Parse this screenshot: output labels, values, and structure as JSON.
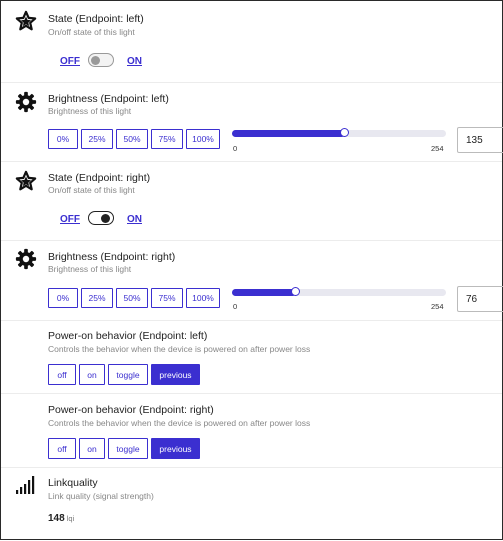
{
  "state_left": {
    "title": "State (Endpoint: left)",
    "description": "On/off state of this light",
    "off_label": "OFF",
    "on_label": "ON",
    "value": "OFF"
  },
  "brightness_left": {
    "title": "Brightness (Endpoint: left)",
    "description": "Brightness of this light",
    "presets": [
      "0%",
      "25%",
      "50%",
      "75%",
      "100%"
    ],
    "min": "0",
    "max": "254",
    "value": "135",
    "slider_fraction": 0.53
  },
  "state_right": {
    "title": "State (Endpoint: right)",
    "description": "On/off state of this light",
    "off_label": "OFF",
    "on_label": "ON",
    "value": "ON"
  },
  "brightness_right": {
    "title": "Brightness (Endpoint: right)",
    "description": "Brightness of this light",
    "presets": [
      "0%",
      "25%",
      "50%",
      "75%",
      "100%"
    ],
    "min": "0",
    "max": "254",
    "value": "76",
    "slider_fraction": 0.3
  },
  "power_on_left": {
    "title": "Power-on behavior (Endpoint: left)",
    "description": "Controls the behavior when the device is powered on after power loss",
    "options": [
      "off",
      "on",
      "toggle",
      "previous"
    ],
    "selected": "previous"
  },
  "power_on_right": {
    "title": "Power-on behavior (Endpoint: right)",
    "description": "Controls the behavior when the device is powered on after power loss",
    "options": [
      "off",
      "on",
      "toggle",
      "previous"
    ],
    "selected": "previous"
  },
  "linkquality": {
    "title": "Linkquality",
    "description": "Link quality (signal strength)",
    "value": "148",
    "unit": "lqi"
  },
  "colors": {
    "accent": "#3b2fd0"
  },
  "icons": {
    "state": "star-icon",
    "brightness": "sun-icon",
    "linkquality": "signal-bars-icon"
  }
}
